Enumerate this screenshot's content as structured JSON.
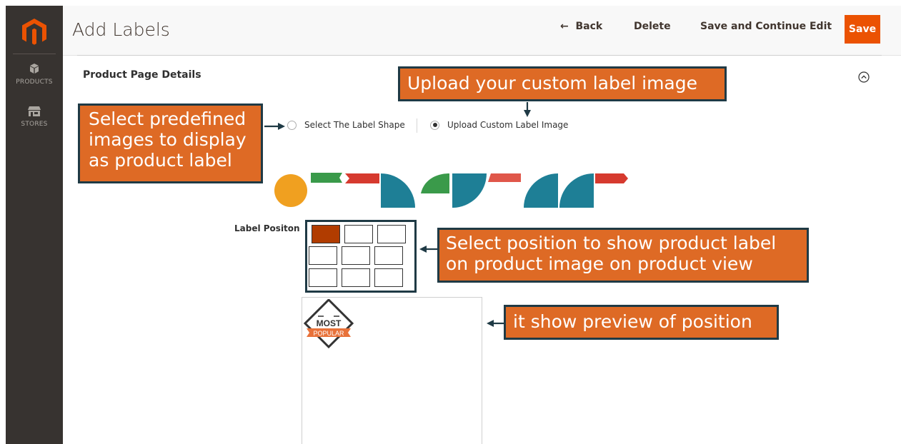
{
  "sidebar": {
    "logo_icon": "magento-logo-icon",
    "items": [
      {
        "label": "PRODUCTS",
        "icon": "cube-icon"
      },
      {
        "label": "STORES",
        "icon": "storefront-icon"
      }
    ]
  },
  "header": {
    "title": "Add Labels",
    "back_label": "Back",
    "back_icon": "arrow-left-icon",
    "delete_label": "Delete",
    "save_continue_label": "Save and Continue Edit",
    "save_label": "Save"
  },
  "section": {
    "title": "Product Page Details",
    "collapse_icon": "chevron-up-circle-icon"
  },
  "label_source": {
    "options": [
      {
        "label": "Select The Label Shape",
        "checked": false
      },
      {
        "label": "Upload Custom Label Image",
        "checked": true
      }
    ]
  },
  "shapes": {
    "count": 9,
    "colors": [
      "#f0a020",
      "#3a9a4a",
      "#d63a2f",
      "#1e7f96",
      "#3a9a4a",
      "#1e7f96",
      "#e0574a",
      "#1e7f96",
      "#d63a2f"
    ]
  },
  "position": {
    "label": "Label Positon",
    "selected_index": 0,
    "cells": 9
  },
  "preview": {
    "badge_top": "MOST",
    "badge_bottom": "POPULAR"
  },
  "annotations": {
    "predefined": [
      "Select predefined",
      "images to display",
      "as product label"
    ],
    "upload": "Upload your custom label image",
    "position": [
      "Select position to show product label",
      "on product image on product view"
    ],
    "preview": "it show preview of position"
  },
  "colors": {
    "sidebar": "#373330",
    "accent": "#eb5202",
    "annotation_fill": "#de6a25",
    "annotation_border": "#1f3a45",
    "selected_cell": "#b13c00"
  }
}
